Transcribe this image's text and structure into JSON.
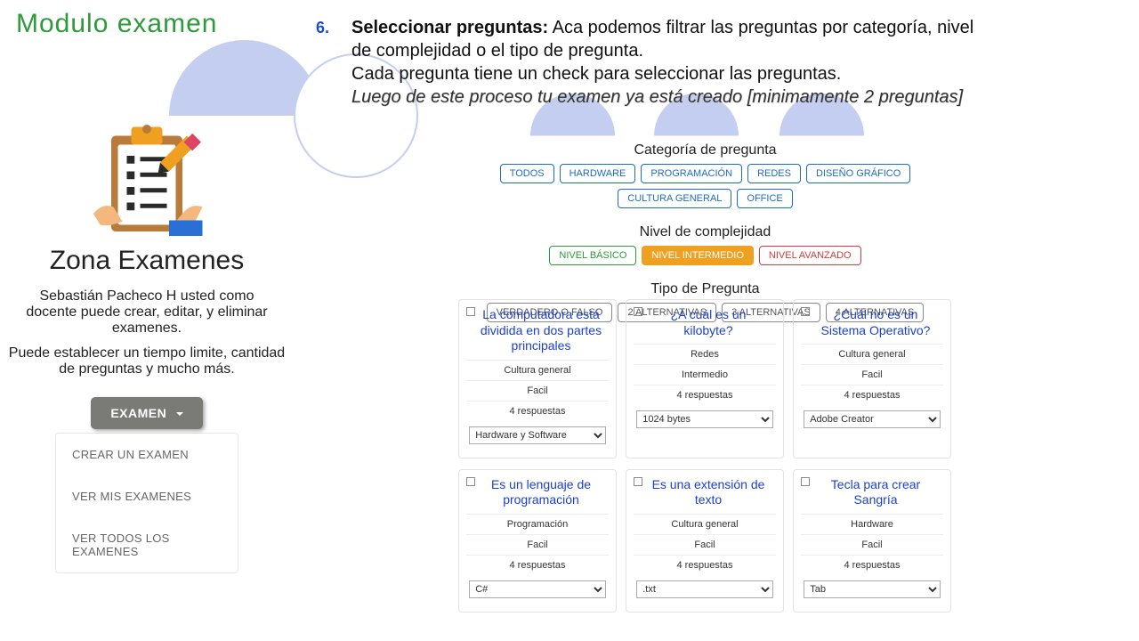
{
  "app_title": "Modulo examen",
  "instruction": {
    "number": "6.",
    "bold": "Seleccionar preguntas:",
    "line1": " Aca podemos filtrar las preguntas por categoría, nivel de complejidad o el tipo de pregunta.",
    "line2": "Cada pregunta tiene un check para seleccionar las preguntas.",
    "italic": "Luego de este proceso tu examen ya está creado [minimamente 2 preguntas]"
  },
  "sidebar": {
    "zone_title": "Zona Examenes",
    "desc1": "Sebastián Pacheco H usted como docente puede crear, editar, y eliminar examenes.",
    "desc2": "Puede establecer un tiempo limite, cantidad de preguntas y mucho más.",
    "button": "EXAMEN",
    "menu": [
      "CREAR UN EXAMEN",
      "VER MIS EXAMENES",
      "VER TODOS LOS EXAMENES"
    ]
  },
  "filters": {
    "category": {
      "label": "Categoría de pregunta",
      "items": [
        "TODOS",
        "HARDWARE",
        "PROGRAMACIÓN",
        "REDES",
        "DISEÑO GRÁFICO",
        "CULTURA GENERAL",
        "OFFICE"
      ]
    },
    "level": {
      "label": "Nivel de complejidad",
      "items": [
        {
          "text": "NIVEL BÁSICO",
          "style": "green"
        },
        {
          "text": "NIVEL INTERMEDIO",
          "style": "orange"
        },
        {
          "text": "NIVEL AVANZADO",
          "style": "red"
        }
      ]
    },
    "type": {
      "label": "Tipo de Pregunta",
      "items": [
        "VERDADERO O FALSO",
        "2 ALTERNATIVAS",
        "3 ALTERNATIVAS",
        "4 ALTERNATIVAS"
      ]
    }
  },
  "questions": [
    {
      "q": "La computadora está dividida en dos partes principales",
      "cat": "Cultura general",
      "lvl": "Facil",
      "resp": "4 respuestas",
      "ans": "Hardware y Software"
    },
    {
      "q": "¿A cuál es un kilobyte?",
      "cat": "Redes",
      "lvl": "Intermedio",
      "resp": "4 respuestas",
      "ans": "1024 bytes"
    },
    {
      "q": "¿Cuál no es un Sistema Operativo?",
      "cat": "Cultura general",
      "lvl": "Facil",
      "resp": "4 respuestas",
      "ans": "Adobe Creator"
    },
    {
      "q": "Es un lenguaje de programación",
      "cat": "Programación",
      "lvl": "Facil",
      "resp": "4 respuestas",
      "ans": "C#"
    },
    {
      "q": "Es una extensión de texto",
      "cat": "Cultura general",
      "lvl": "Facil",
      "resp": "4 respuestas",
      "ans": ".txt"
    },
    {
      "q": "Tecla para crear Sangría",
      "cat": "Hardware",
      "lvl": "Facil",
      "resp": "4 respuestas",
      "ans": "Tab"
    }
  ]
}
